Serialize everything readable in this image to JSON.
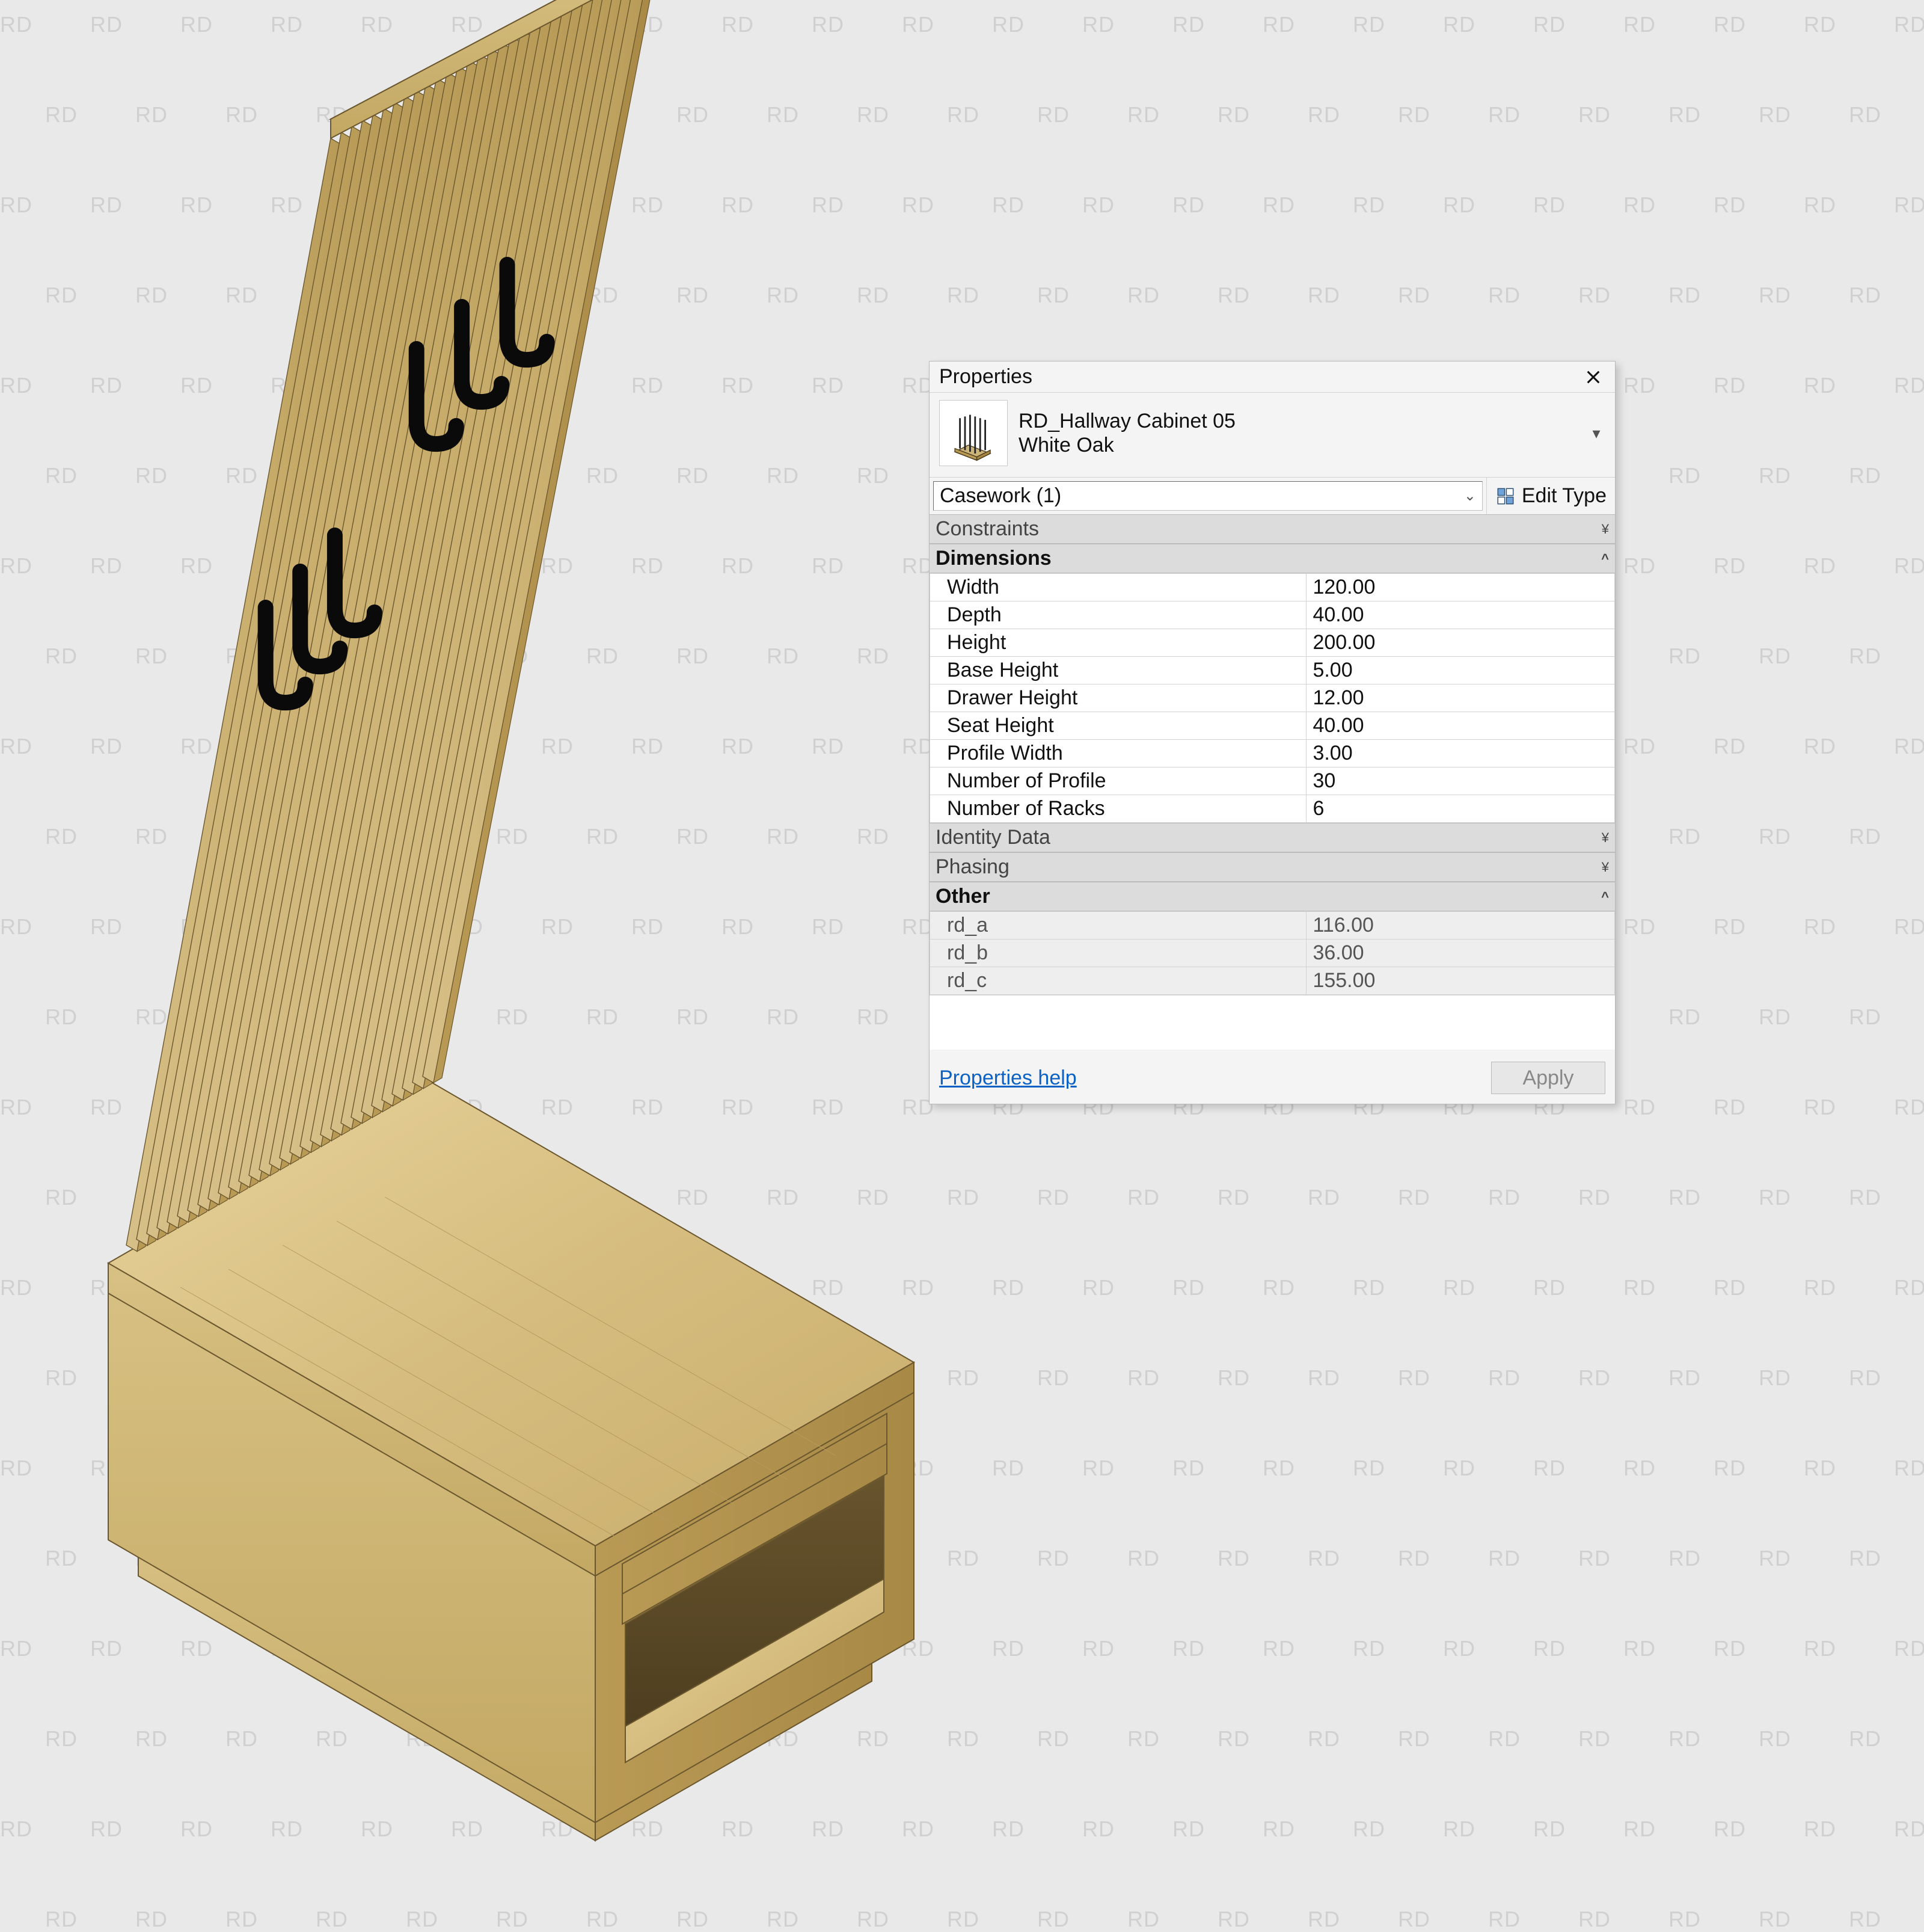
{
  "watermark": "RD",
  "palette": {
    "title": "Properties",
    "family": {
      "name": "RD_Hallway Cabinet 05",
      "type": "White Oak"
    },
    "category": "Casework (1)",
    "editType": "Edit Type",
    "sections": {
      "constraints": "Constraints",
      "dimensions": "Dimensions",
      "identity": "Identity Data",
      "phasing": "Phasing",
      "other": "Other"
    },
    "dims": [
      {
        "k": "Width",
        "v": "120.00"
      },
      {
        "k": "Depth",
        "v": "40.00"
      },
      {
        "k": "Height",
        "v": "200.00"
      },
      {
        "k": "Base Height",
        "v": "5.00"
      },
      {
        "k": "Drawer Height",
        "v": "12.00"
      },
      {
        "k": "Seat Height",
        "v": "40.00"
      },
      {
        "k": "Profile Width",
        "v": "3.00"
      },
      {
        "k": "Number of Profile",
        "v": "30"
      },
      {
        "k": "Number of Racks",
        "v": "6"
      }
    ],
    "other": [
      {
        "k": "rd_a",
        "v": "116.00"
      },
      {
        "k": "rd_b",
        "v": "36.00"
      },
      {
        "k": "rd_c",
        "v": "155.00"
      }
    ],
    "help": "Properties help",
    "apply": "Apply"
  }
}
